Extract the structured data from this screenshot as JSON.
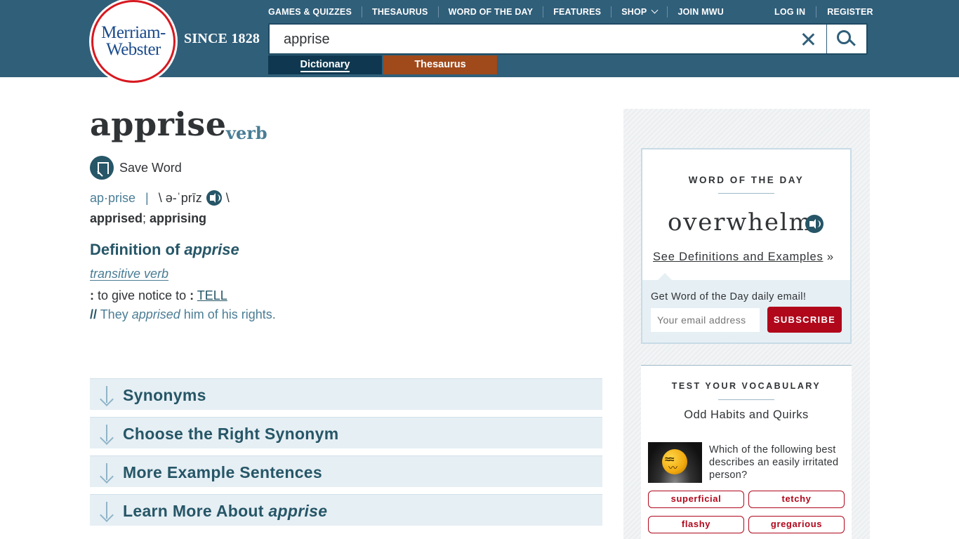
{
  "header": {
    "logo_line1": "Merriam-",
    "logo_line2": "Webster",
    "since": "SINCE 1828",
    "nav": [
      "GAMES & QUIZZES",
      "THESAURUS",
      "WORD OF THE DAY",
      "FEATURES",
      "SHOP",
      "JOIN MWU"
    ],
    "login": "LOG IN",
    "register": "REGISTER",
    "search_value": "apprise",
    "tab_dictionary": "Dictionary",
    "tab_thesaurus": "Thesaurus"
  },
  "entry": {
    "headword": "apprise",
    "pos": "verb",
    "save_label": "Save Word",
    "syllables": "ap·prise",
    "separator": "|",
    "pron_open": "\\ ə-ˈprīz",
    "pron_close": "\\",
    "inflection1": "apprised",
    "inflection_sep": "; ",
    "inflection2": "apprising",
    "def_heading_prefix": "Definition of ",
    "def_heading_word": "apprise",
    "function_label": "transitive verb",
    "sense_colon": ":",
    "sense_text": " to give notice to ",
    "sense_colon2": ":",
    "sense_link": "TELL",
    "example_slashes": "//",
    "example_before": " They ",
    "example_italic": "apprised",
    "example_after": " him of his rights."
  },
  "accordions": {
    "synonyms": "Synonyms",
    "choose": "Choose the Right Synonym",
    "examples": "More Example Sentences",
    "learn_prefix": "Learn More About ",
    "learn_word": "apprise"
  },
  "wotd": {
    "title": "WORD OF THE DAY",
    "word": "overwhelm",
    "link": "See Definitions and Examples",
    "link_suffix": " »",
    "email_label": "Get Word of the Day daily email!",
    "email_placeholder": "Your email address",
    "subscribe": "SUBSCRIBE"
  },
  "vocab": {
    "title": "TEST YOUR VOCABULARY",
    "subtitle": "Odd Habits and Quirks",
    "question": "Which of the following best describes an easily irritated person?",
    "options": [
      "superficial",
      "tetchy",
      "flashy",
      "gregarious"
    ]
  },
  "colors": {
    "header_bg": "#305f7a",
    "dictionary_tab": "#0f3850",
    "thesaurus_tab": "#a0491a",
    "accent_red": "#b0071b",
    "heading_blue": "#265667"
  }
}
